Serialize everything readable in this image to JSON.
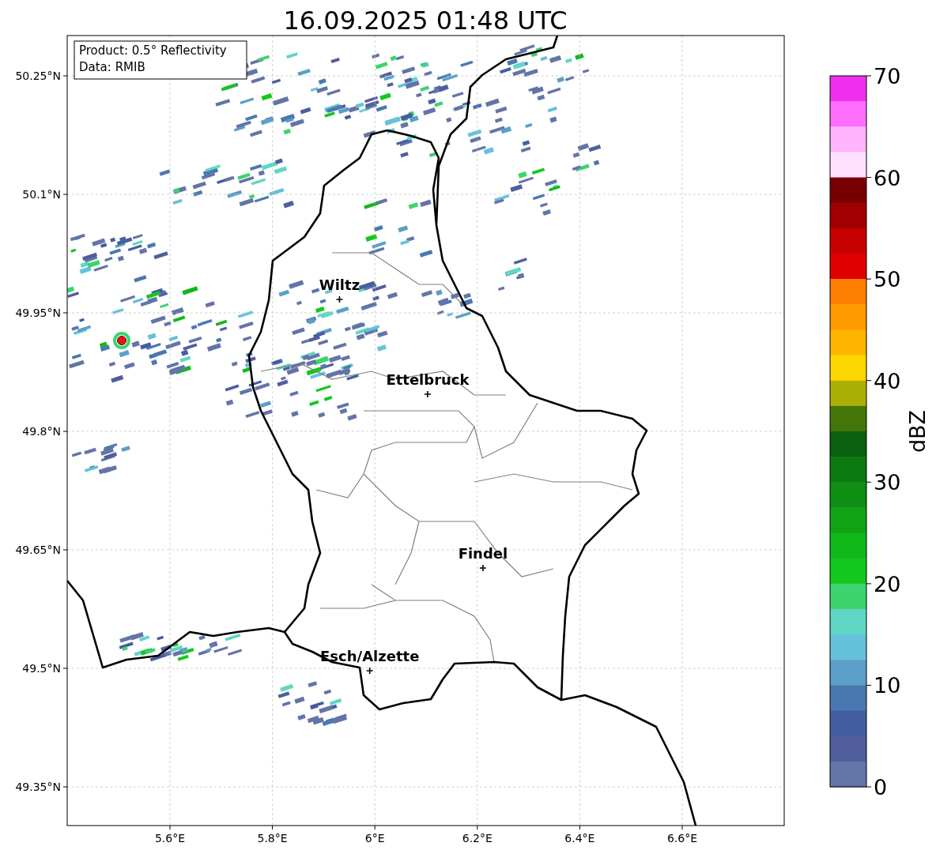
{
  "title": "16.09.2025 01:48 UTC",
  "map": {
    "info_box": [
      "Product: 0.5° Reflectivity",
      "Data: RMIB"
    ],
    "xticks": [
      "5.6°E",
      "5.8°E",
      "6°E",
      "6.2°E",
      "6.4°E",
      "6.6°E"
    ],
    "yticks": [
      "50.25°N",
      "50.1°N",
      "49.95°N",
      "49.8°N",
      "49.65°N",
      "49.5°N",
      "49.35°N"
    ],
    "cities": [
      {
        "name": "Wiltz"
      },
      {
        "name": "Ettelbruck"
      },
      {
        "name": "Findel"
      },
      {
        "name": "Esch/Alzette"
      }
    ]
  },
  "colorbar": {
    "label": "dBZ",
    "ticks": [
      "70",
      "60",
      "50",
      "40",
      "30",
      "20",
      "10",
      "0"
    ],
    "segments": [
      {
        "color": "#ee30ee"
      },
      {
        "color": "#ff6eff"
      },
      {
        "color": "#ffb4ff"
      },
      {
        "color": "#ffe0ff"
      },
      {
        "color": "#780000"
      },
      {
        "color": "#a00000"
      },
      {
        "color": "#c80000"
      },
      {
        "color": "#e00000"
      },
      {
        "color": "#ff7f00"
      },
      {
        "color": "#ff9900"
      },
      {
        "color": "#ffb400"
      },
      {
        "color": "#ffd700"
      },
      {
        "color": "#adb004"
      },
      {
        "color": "#44760c"
      },
      {
        "color": "#0a600e"
      },
      {
        "color": "#0b7a10"
      },
      {
        "color": "#0e8e12"
      },
      {
        "color": "#10a414"
      },
      {
        "color": "#10b81a"
      },
      {
        "color": "#14c81e"
      },
      {
        "color": "#3dd46e"
      },
      {
        "color": "#60d6c4"
      },
      {
        "color": "#66c1dc"
      },
      {
        "color": "#5aa0c8"
      },
      {
        "color": "#4a78b0"
      },
      {
        "color": "#435ea0"
      },
      {
        "color": "#505f9c"
      },
      {
        "color": "#6374a8"
      }
    ]
  }
}
